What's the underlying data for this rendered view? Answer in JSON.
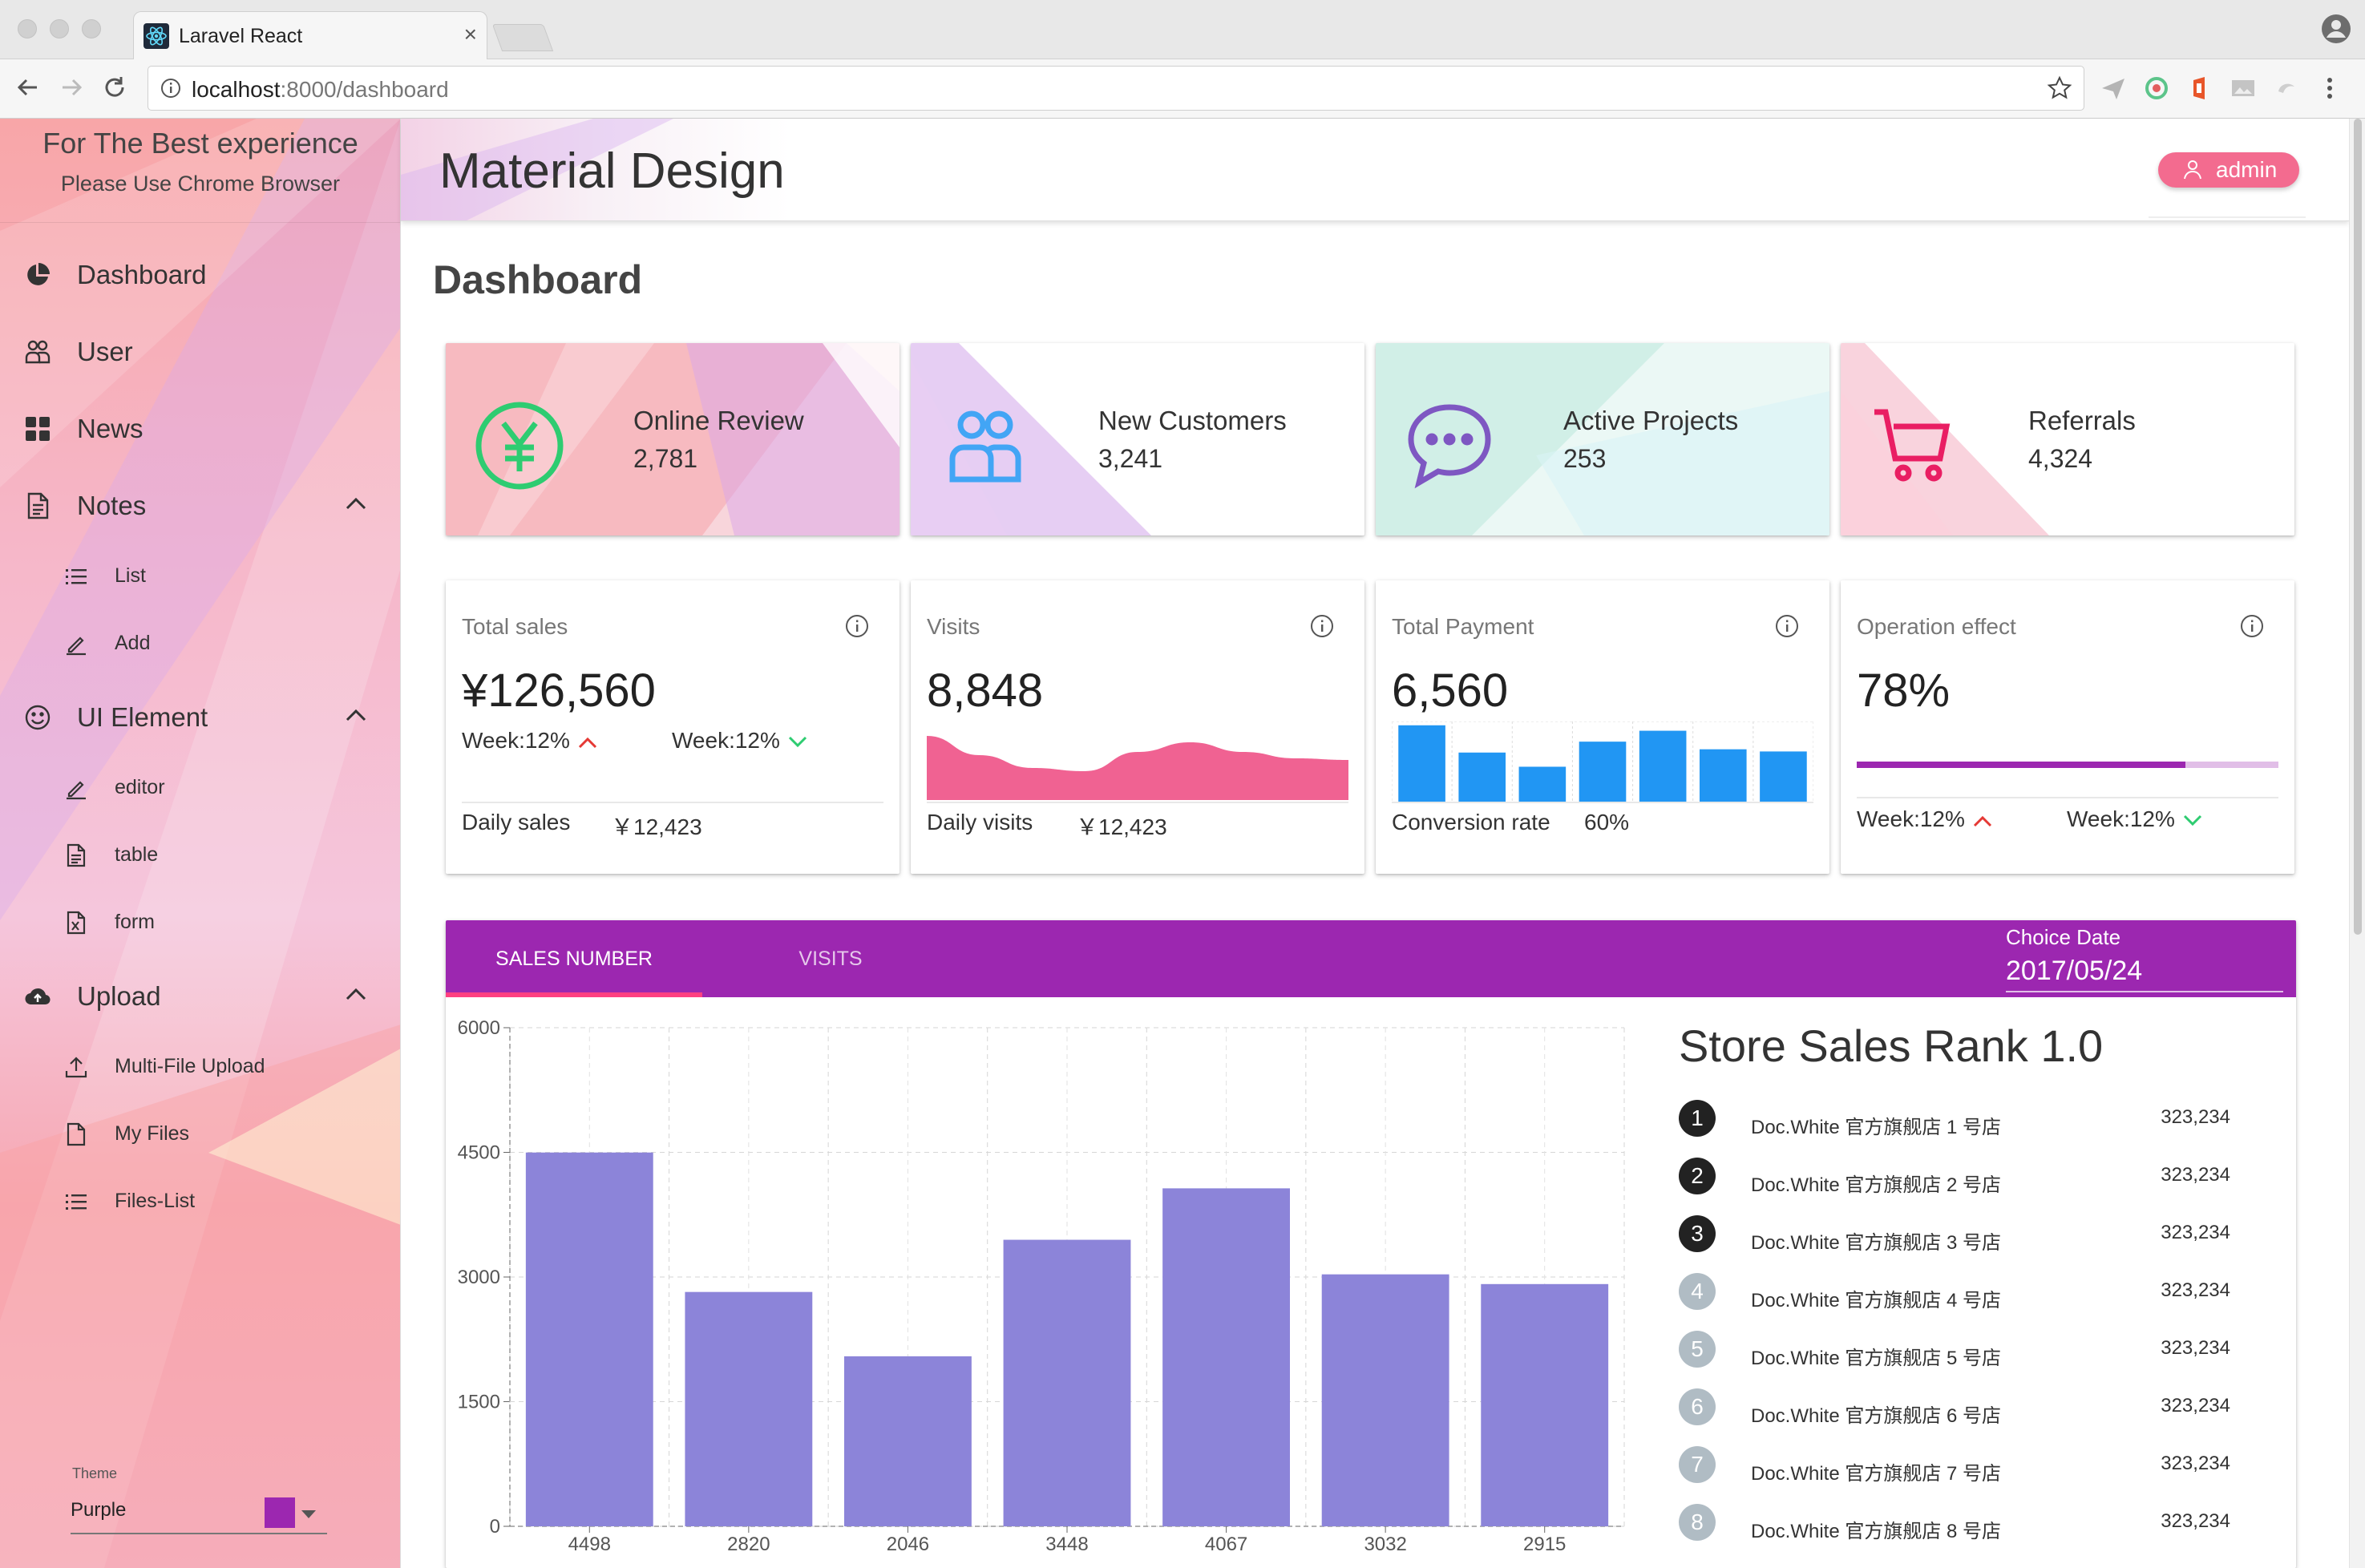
{
  "browser": {
    "tab_title": "Laravel React",
    "tab_close": "×",
    "url_host": "localhost",
    "url_path": ":8000/dashboard"
  },
  "sidebar": {
    "notice_line1": "For The Best experience",
    "notice_line2": "Please Use Chrome Browser",
    "items": [
      {
        "label": "Dashboard",
        "icon": "pie-chart-icon"
      },
      {
        "label": "User",
        "icon": "users-icon"
      },
      {
        "label": "News",
        "icon": "grid-icon"
      },
      {
        "label": "Notes",
        "icon": "document-icon",
        "expanded": true,
        "children": [
          {
            "label": "List",
            "icon": "list-icon"
          },
          {
            "label": "Add",
            "icon": "pencil-icon"
          }
        ]
      },
      {
        "label": "UI Element",
        "icon": "smile-icon",
        "expanded": true,
        "children": [
          {
            "label": "editor",
            "icon": "pencil-icon"
          },
          {
            "label": "table",
            "icon": "document-icon"
          },
          {
            "label": "form",
            "icon": "excel-file-icon"
          }
        ]
      },
      {
        "label": "Upload",
        "icon": "cloud-upload-icon",
        "expanded": true,
        "children": [
          {
            "label": "Multi-File Upload",
            "icon": "upload-icon"
          },
          {
            "label": "My Files",
            "icon": "file-icon"
          },
          {
            "label": "Files-List",
            "icon": "list-icon"
          }
        ]
      }
    ],
    "theme": {
      "label": "Theme",
      "value": "Purple",
      "color": "#9c27b0"
    }
  },
  "header": {
    "title": "Material Design",
    "user_button": "admin",
    "user_button_color": "#f36b8f"
  },
  "page": {
    "heading": "Dashboard"
  },
  "stat_cards": [
    {
      "title": "Online Review",
      "value": "2,781",
      "icon": "yen-icon",
      "color": "#2ecc71"
    },
    {
      "title": "New Customers",
      "value": "3,241",
      "icon": "users-icon",
      "color": "#42a5f5"
    },
    {
      "title": "Active Projects",
      "value": "253",
      "icon": "chat-icon",
      "color": "#7e57c2"
    },
    {
      "title": "Referrals",
      "value": "4,324",
      "icon": "cart-icon",
      "color": "#e91e63"
    }
  ],
  "metric_cards": [
    {
      "title": "Total sales",
      "value": "¥126,560",
      "week_up": "Week:12%",
      "week_down": "Week:12%",
      "footer_label": "Daily sales",
      "footer_value": "￥12,423"
    },
    {
      "title": "Visits",
      "value": "8,848",
      "footer_label": "Daily visits",
      "footer_value": "￥12,423"
    },
    {
      "title": "Total Payment",
      "value": "6,560",
      "footer_label": "Conversion rate",
      "footer_value": "60%"
    },
    {
      "title": "Operation effect",
      "value": "78%",
      "progress": 0.78,
      "week_up": "Week:12%",
      "week_down": "Week:12%"
    }
  ],
  "panel": {
    "tabs": [
      {
        "label": "SALES NUMBER",
        "active": true
      },
      {
        "label": "VISITS",
        "active": false
      }
    ],
    "date_label": "Choice Date",
    "date_value": "2017/05/24",
    "accent": "#9c27b0",
    "indicator_color": "#ff4081"
  },
  "chart_data": [
    {
      "type": "bar",
      "categories": [
        "4498",
        "2820",
        "2046",
        "3448",
        "4067",
        "3032",
        "2915"
      ],
      "values": [
        4498,
        2820,
        2046,
        3448,
        4067,
        3032,
        2915
      ],
      "title": "",
      "xlabel": "",
      "ylabel": "",
      "ylim": [
        0,
        6000
      ],
      "yticks": [
        0,
        1500,
        3000,
        4500,
        6000
      ],
      "grid": true,
      "color": "#8c84d9"
    },
    {
      "type": "area",
      "values": [
        40,
        28,
        20,
        18,
        30,
        36,
        30,
        26,
        25
      ],
      "color": "#f06292"
    },
    {
      "type": "bar",
      "values": [
        7,
        4.5,
        3.2,
        5.5,
        6.5,
        4.8,
        4.6
      ],
      "color": "#2196f3"
    }
  ],
  "rank": {
    "title": "Store Sales Rank 1.0",
    "items": [
      {
        "rank": "1",
        "name": "Doc.White 官方旗舰店 1 号店",
        "value": "323,234"
      },
      {
        "rank": "2",
        "name": "Doc.White 官方旗舰店 2 号店",
        "value": "323,234"
      },
      {
        "rank": "3",
        "name": "Doc.White 官方旗舰店 3 号店",
        "value": "323,234"
      },
      {
        "rank": "4",
        "name": "Doc.White 官方旗舰店 4 号店",
        "value": "323,234"
      },
      {
        "rank": "5",
        "name": "Doc.White 官方旗舰店 5 号店",
        "value": "323,234"
      },
      {
        "rank": "6",
        "name": "Doc.White 官方旗舰店 6 号店",
        "value": "323,234"
      },
      {
        "rank": "7",
        "name": "Doc.White 官方旗舰店 7 号店",
        "value": "323,234"
      },
      {
        "rank": "8",
        "name": "Doc.White 官方旗舰店 8 号店",
        "value": "323,234"
      }
    ],
    "top_color": "#222222",
    "other_color": "#b0bcc4"
  }
}
